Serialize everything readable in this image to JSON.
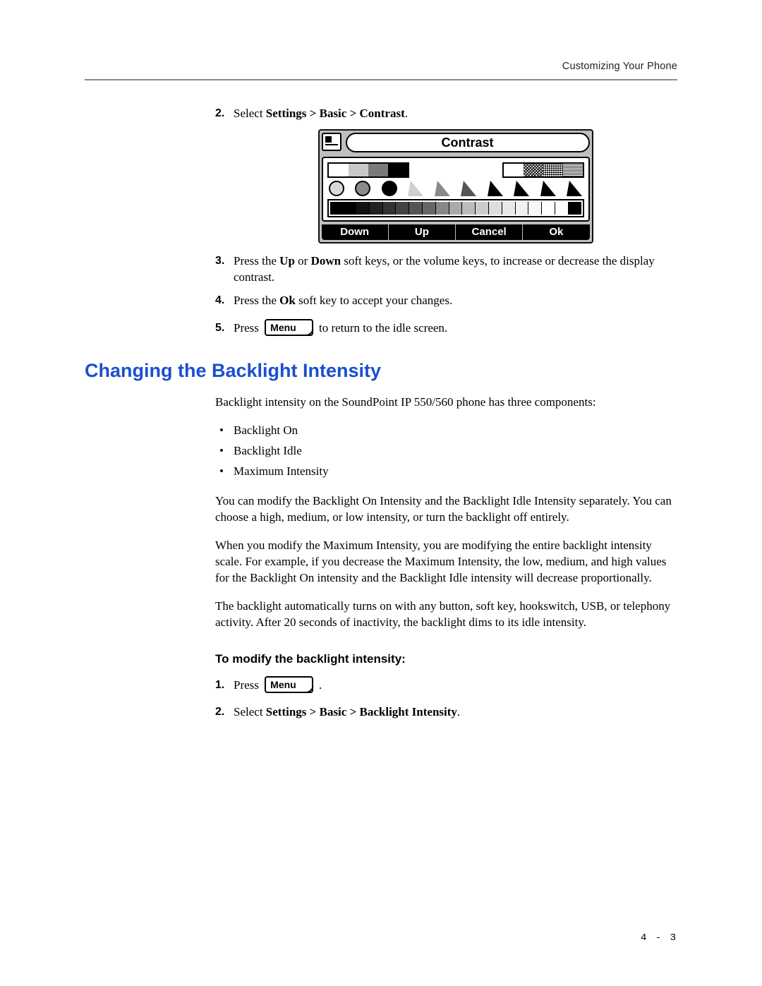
{
  "header": {
    "running_head": "Customizing Your Phone"
  },
  "contrast_steps": {
    "step2": {
      "num": "2.",
      "pre": "Select ",
      "bold": "Settings > Basic > Contrast",
      "post": "."
    },
    "step3": {
      "num": "3.",
      "a": "Press the ",
      "up": "Up",
      "b": " or ",
      "down": "Down",
      "c": " soft keys, or the volume keys, to increase or decrease the display contrast."
    },
    "step4": {
      "num": "4.",
      "a": "Press the ",
      "ok": "Ok",
      "b": " soft key to accept your changes."
    },
    "step5": {
      "num": "5.",
      "a": "Press ",
      "menu_label": "Menu",
      "b": " to return to the idle screen."
    }
  },
  "lcd": {
    "title": "Contrast",
    "softkeys": [
      "Down",
      "Up",
      "Cancel",
      "Ok"
    ]
  },
  "section": {
    "heading": "Changing the Backlight Intensity",
    "intro": "Backlight intensity on the SoundPoint IP 550/560 phone has three components:",
    "bullets": [
      "Backlight On",
      "Backlight Idle",
      "Maximum Intensity"
    ],
    "p2": "You can modify the Backlight On Intensity and the Backlight Idle Intensity separately. You can choose a high, medium, or low intensity, or turn the backlight off entirely.",
    "p3": "When you modify the Maximum Intensity, you are modifying the entire backlight intensity scale. For example, if you decrease the Maximum Intensity, the low, medium, and high values for the Backlight On intensity and the Backlight Idle intensity will decrease proportionally.",
    "p4": "The backlight automatically turns on with any button, soft key, hookswitch, USB, or telephony activity. After 20 seconds of inactivity, the backlight dims to its idle intensity.",
    "subheading": "To modify the backlight intensity:",
    "steps": {
      "s1": {
        "num": "1.",
        "a": "Press ",
        "menu_label": "Menu",
        "b": " ."
      },
      "s2": {
        "num": "2.",
        "a": "Select ",
        "bold": "Settings > Basic > Backlight Intensity",
        "b": "."
      }
    }
  },
  "footer": {
    "page_number": "4 - 3"
  }
}
